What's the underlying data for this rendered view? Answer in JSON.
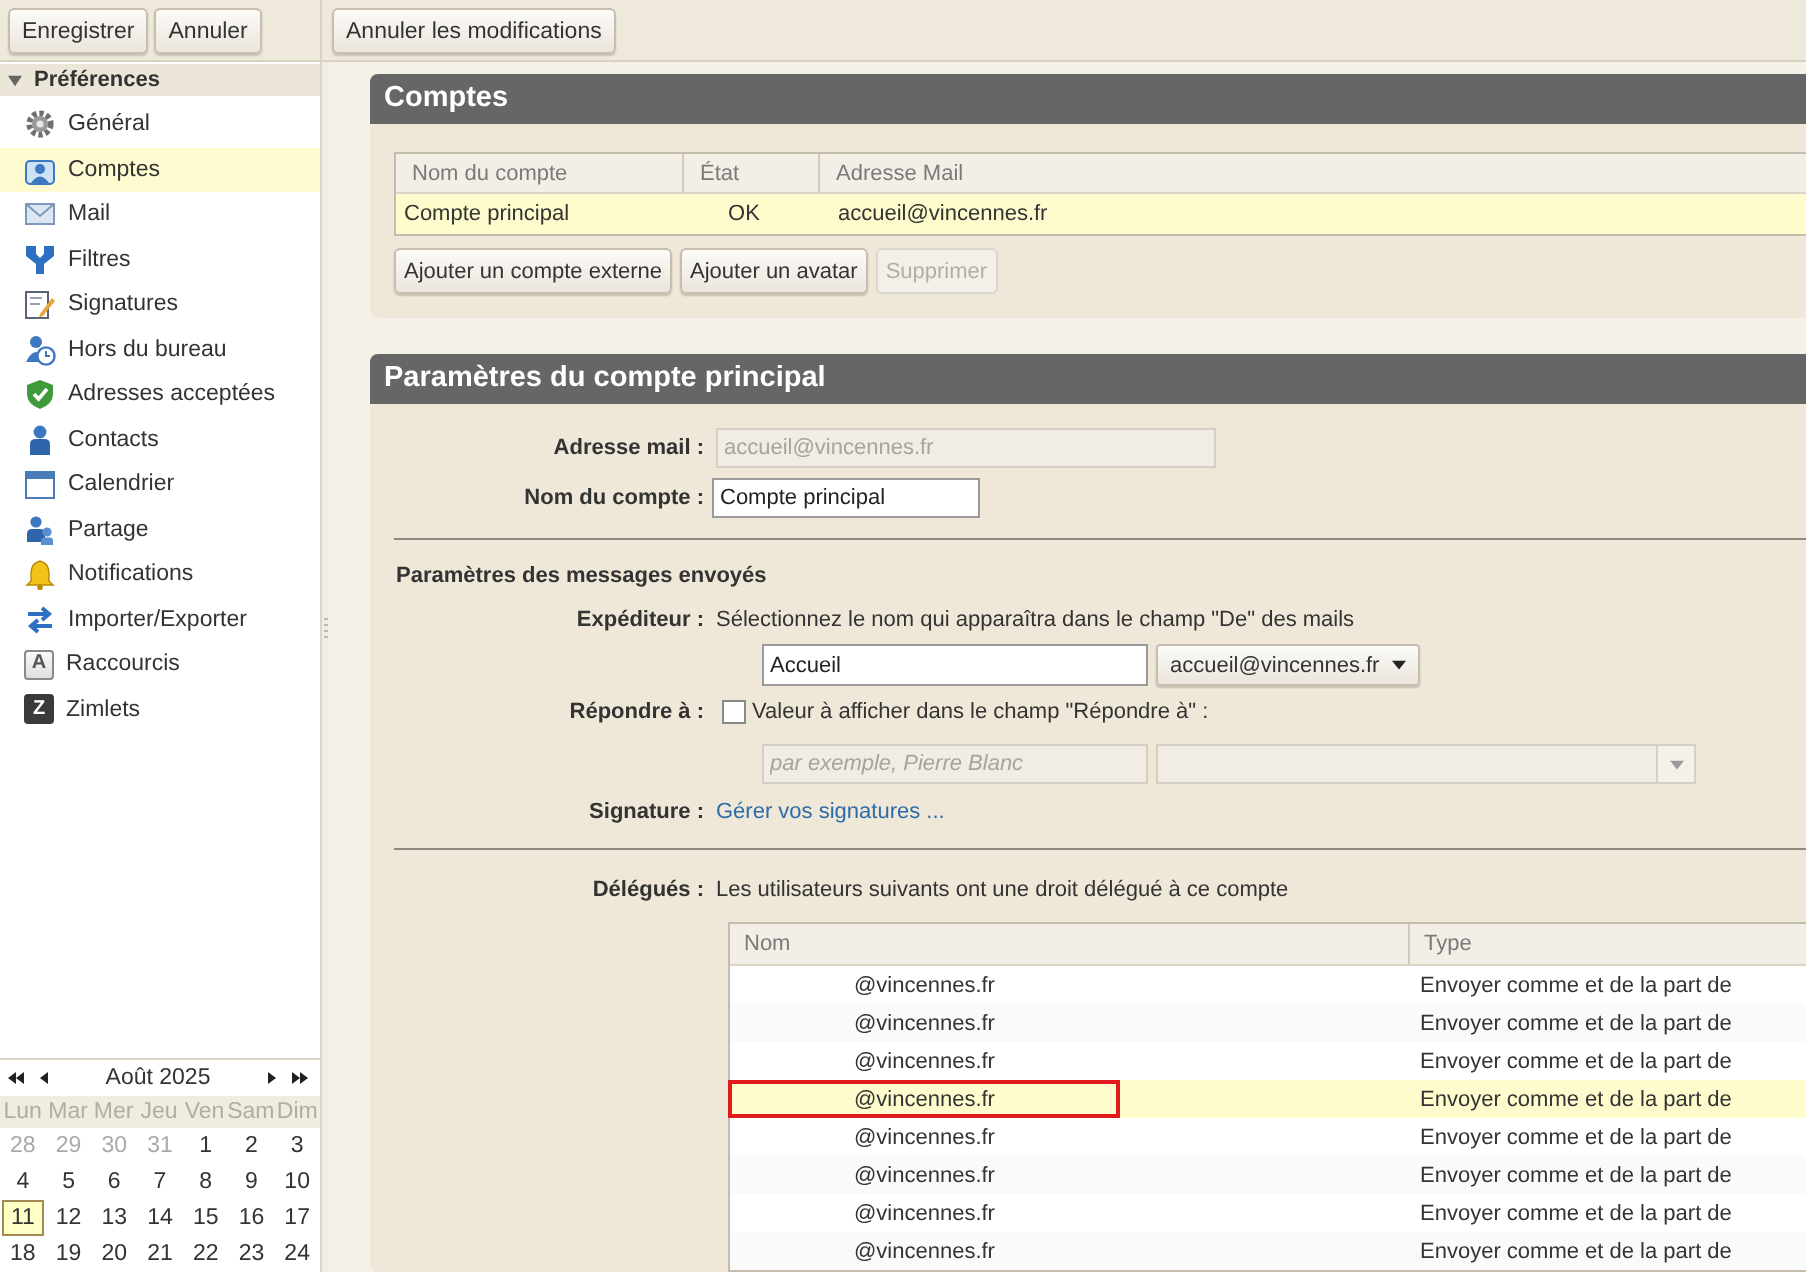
{
  "toolbar": {
    "buttons": [
      {
        "label": "Enregistrer"
      },
      {
        "label": "Annuler"
      }
    ],
    "content_buttons": [
      {
        "label": "Annuler les modifications"
      }
    ]
  },
  "sidebar": {
    "title": "Préférences",
    "expanded": true,
    "items": [
      {
        "label": "Général",
        "selected": false
      },
      {
        "label": "Comptes",
        "selected": true
      },
      {
        "label": "Mail",
        "selected": false
      },
      {
        "label": "Filtres",
        "selected": false
      },
      {
        "label": "Signatures",
        "selected": false
      },
      {
        "label": "Hors du bureau",
        "selected": false
      },
      {
        "label": "Adresses acceptées",
        "selected": false
      },
      {
        "label": "Contacts",
        "selected": false
      },
      {
        "label": "Calendrier",
        "selected": false
      },
      {
        "label": "Partage",
        "selected": false
      },
      {
        "label": "Notifications",
        "selected": false
      },
      {
        "label": "Importer/Exporter",
        "selected": false
      },
      {
        "label": "Raccourcis",
        "selected": false,
        "icon_text": "A"
      },
      {
        "label": "Zimlets",
        "selected": false,
        "icon_text": "Z"
      }
    ]
  },
  "calendar": {
    "month": "Août 2025",
    "weekdays": [
      "Lun",
      "Mar",
      "Mer",
      "Jeu",
      "Ven",
      "Sam",
      "Dim"
    ],
    "weeks": [
      [
        {
          "day": "28",
          "other_month": true,
          "today": false
        },
        {
          "day": "29",
          "other_month": true,
          "today": false
        },
        {
          "day": "30",
          "other_month": true,
          "today": false
        },
        {
          "day": "31",
          "other_month": true,
          "today": false
        },
        {
          "day": "1",
          "other_month": false,
          "today": false
        },
        {
          "day": "2",
          "other_month": false,
          "today": false
        },
        {
          "day": "3",
          "other_month": false,
          "today": false
        }
      ],
      [
        {
          "day": "4",
          "other_month": false,
          "today": false
        },
        {
          "day": "5",
          "other_month": false,
          "today": false
        },
        {
          "day": "6",
          "other_month": false,
          "today": false
        },
        {
          "day": "7",
          "other_month": false,
          "today": false
        },
        {
          "day": "8",
          "other_month": false,
          "today": false
        },
        {
          "day": "9",
          "other_month": false,
          "today": false
        },
        {
          "day": "10",
          "other_month": false,
          "today": false
        }
      ],
      [
        {
          "day": "11",
          "other_month": false,
          "today": true
        },
        {
          "day": "12",
          "other_month": false,
          "today": false
        },
        {
          "day": "13",
          "other_month": false,
          "today": false
        },
        {
          "day": "14",
          "other_month": false,
          "today": false
        },
        {
          "day": "15",
          "other_month": false,
          "today": false
        },
        {
          "day": "16",
          "other_month": false,
          "today": false
        },
        {
          "day": "17",
          "other_month": false,
          "today": false
        }
      ],
      [
        {
          "day": "18",
          "other_month": false,
          "today": false
        },
        {
          "day": "19",
          "other_month": false,
          "today": false
        },
        {
          "day": "20",
          "other_month": false,
          "today": false
        },
        {
          "day": "21",
          "other_month": false,
          "today": false
        },
        {
          "day": "22",
          "other_month": false,
          "today": false
        },
        {
          "day": "23",
          "other_month": false,
          "today": false
        },
        {
          "day": "24",
          "other_month": false,
          "today": false
        }
      ]
    ]
  },
  "accounts": {
    "title": "Comptes",
    "columns": [
      "Nom du compte",
      "État",
      "Adresse Mail"
    ],
    "rows": [
      {
        "name": "Compte principal",
        "status": "OK",
        "email": "accueil@vincennes.fr",
        "selected": true
      }
    ],
    "buttons": [
      {
        "label": "Ajouter un compte externe",
        "disabled": false
      },
      {
        "label": "Ajouter un avatar",
        "disabled": false
      },
      {
        "label": "Supprimer",
        "disabled": true
      }
    ]
  },
  "account_settings": {
    "title": "Paramètres du compte principal",
    "email": {
      "label": "Adresse mail :",
      "value": "accueil@vincennes.fr",
      "disabled": true
    },
    "account_name": {
      "label": "Nom du compte :",
      "value": "Compte principal"
    },
    "sent_messages": {
      "title": "Paramètres des messages envoyés",
      "sender": {
        "label": "Expéditeur :",
        "hint": "Sélectionnez le nom qui apparaîtra dans le champ \"De\" des mails",
        "name_value": "Accueil",
        "address_value": "accueil@vincennes.fr"
      },
      "reply_to": {
        "label": "Répondre à :",
        "checked": false,
        "text": "Valeur à afficher dans le champ \"Répondre à\" :",
        "name_placeholder": "par exemple, Pierre Blanc"
      },
      "signature": {
        "label": "Signature :",
        "link": "Gérer vos signatures ..."
      }
    }
  },
  "delegates": {
    "label": "Délégués :",
    "text": "Les utilisateurs suivants ont une droit délégué à ce compte",
    "columns": [
      "Nom",
      "Type"
    ],
    "rows": [
      {
        "name": "@vincennes.fr",
        "type": "Envoyer comme et de la part de",
        "selected": false,
        "outlined": false
      },
      {
        "name": "@vincennes.fr",
        "type": "Envoyer comme et de la part de",
        "selected": false,
        "outlined": false
      },
      {
        "name": "@vincennes.fr",
        "type": "Envoyer comme et de la part de",
        "selected": false,
        "outlined": false
      },
      {
        "name": "@vincennes.fr",
        "type": "Envoyer comme et de la part de",
        "selected": true,
        "outlined": true
      },
      {
        "name": "@vincennes.fr",
        "type": "Envoyer comme et de la part de",
        "selected": false,
        "outlined": false
      },
      {
        "name": "@vincennes.fr",
        "type": "Envoyer comme et de la part de",
        "selected": false,
        "outlined": false
      },
      {
        "name": "@vincennes.fr",
        "type": "Envoyer comme et de la part de",
        "selected": false,
        "outlined": false
      },
      {
        "name": "@vincennes.fr",
        "type": "Envoyer comme et de la part de",
        "selected": false,
        "outlined": false
      }
    ]
  }
}
